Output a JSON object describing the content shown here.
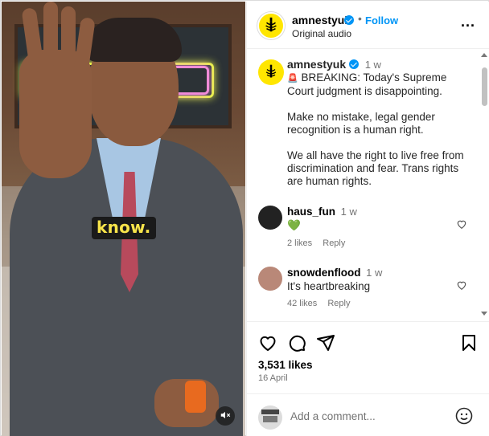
{
  "media": {
    "caption_text": "know.",
    "mute_icon": "speaker-muted-icon"
  },
  "header": {
    "username": "amnestyuk",
    "dot": "•",
    "follow_label": "Follow",
    "subtitle": "Original audio",
    "more_label": "..."
  },
  "post": {
    "username": "amnestyuk",
    "time": "1 w",
    "siren": "🚨",
    "lines": [
      "BREAKING: Today's Supreme Court judgment is disappointing.",
      "Make no mistake, legal gender recognition is a human right.",
      "We all have the right to live free from discrimination and fear. Trans rights are human rights."
    ]
  },
  "comments": [
    {
      "username": "haus_fun",
      "time": "1 w",
      "text": "💚",
      "likes": "2 likes",
      "reply": "Reply"
    },
    {
      "username": "snowdenflood",
      "time": "1 w",
      "text": "It's heartbreaking",
      "likes": "42 likes",
      "reply": "Reply"
    }
  ],
  "actions": {
    "likes": "3,531 likes",
    "date": "16 April"
  },
  "add_comment": {
    "placeholder": "Add a comment..."
  },
  "colors": {
    "accent": "#0095f6",
    "brand_yellow": "#ffe600",
    "caption_yellow": "#f7e44a"
  }
}
